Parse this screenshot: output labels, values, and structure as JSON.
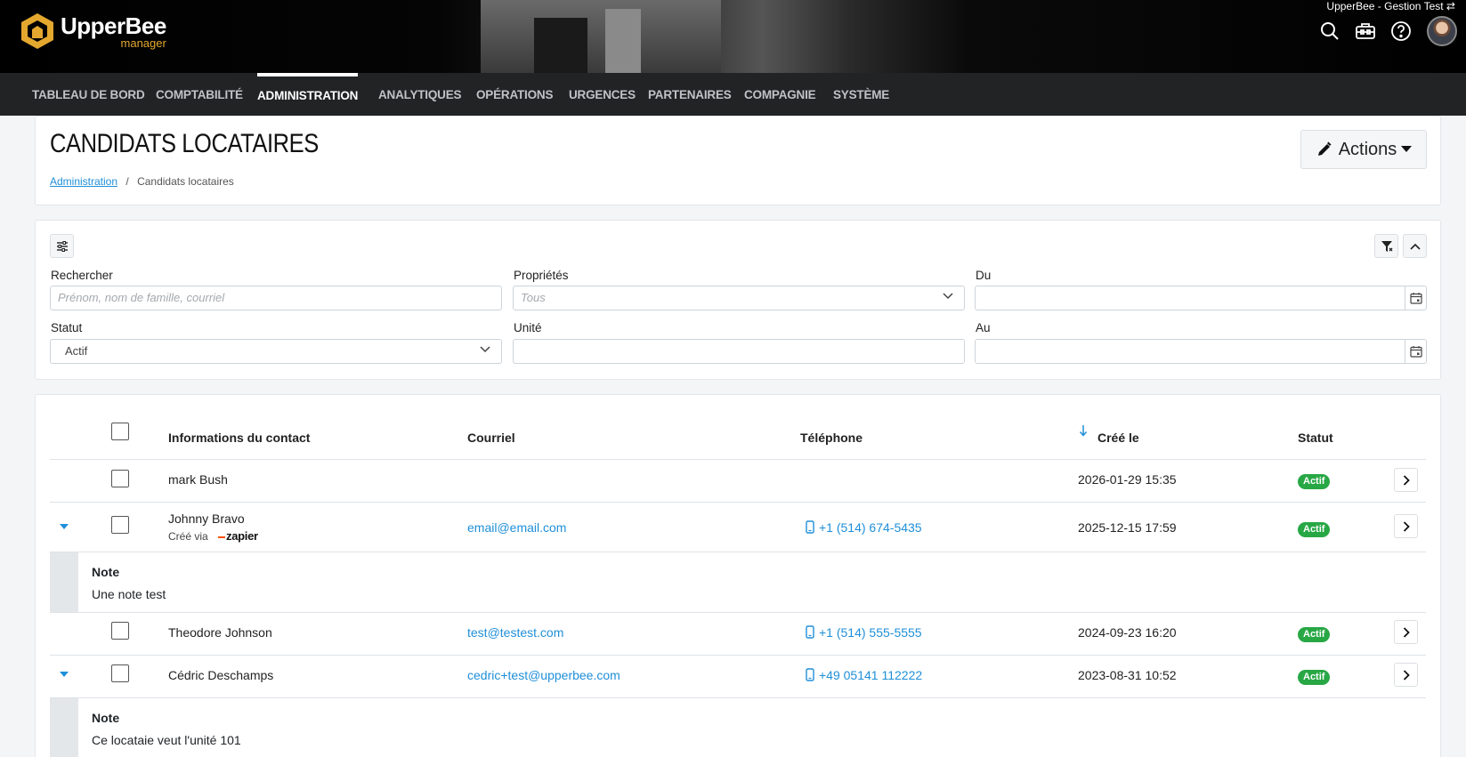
{
  "header": {
    "brand_name": "UpperBee",
    "brand_sub": "manager",
    "account_label": "UpperBee - Gestion Test ⇄"
  },
  "icons": [
    "search-icon",
    "toolbox-icon",
    "help-icon",
    "avatar"
  ],
  "nav": {
    "items": [
      {
        "label": "TABLEAU DE BORD",
        "active": false
      },
      {
        "label": "COMPTABILITÉ",
        "active": false
      },
      {
        "label": "ADMINISTRATION",
        "active": true
      },
      {
        "label": "ANALYTIQUES",
        "active": false
      },
      {
        "label": "OPÉRATIONS",
        "active": false
      },
      {
        "label": "URGENCES",
        "active": false
      },
      {
        "label": "PARTENAIRES",
        "active": false
      },
      {
        "label": "COMPAGNIE",
        "active": false
      },
      {
        "label": "SYSTÈME",
        "active": false
      }
    ]
  },
  "page": {
    "title": "CANDIDATS LOCATAIRES",
    "breadcrumb_link": "Administration",
    "breadcrumb_sep": "/",
    "breadcrumb_current": "Candidats locataires",
    "actions_label": "Actions"
  },
  "filters": {
    "search_label": "Rechercher",
    "search_placeholder": "Prénom, nom de famille, courriel",
    "properties_label": "Propriétés",
    "properties_value": "Tous",
    "from_label": "Du",
    "status_label": "Statut",
    "status_value": "Actif",
    "unit_label": "Unité",
    "to_label": "Au"
  },
  "table": {
    "headers": {
      "contact": "Informations du contact",
      "email": "Courriel",
      "phone": "Téléphone",
      "created": "Créé le",
      "status": "Statut"
    },
    "rows": [
      {
        "name": "mark Bush",
        "email": "",
        "phone": "",
        "created": "2026-01-29 15:35",
        "status": "Actif",
        "expanded": false
      },
      {
        "name": "Johnny Bravo",
        "via_label": "Créé via",
        "via_source": "zapier",
        "email": "email@email.com",
        "phone": "+1 (514) 674-5435",
        "created": "2025-12-15 17:59",
        "status": "Actif",
        "expanded": true,
        "note_title": "Note",
        "note_text": "Une note test"
      },
      {
        "name": "Theodore Johnson",
        "email": "test@testest.com",
        "phone": "+1 (514) 555-5555",
        "created": "2024-09-23 16:20",
        "status": "Actif",
        "expanded": false
      },
      {
        "name": "Cédric Deschamps",
        "email": "cedric+test@upperbee.com",
        "phone": "+49 05141 112222",
        "created": "2023-08-31 10:52",
        "status": "Actif",
        "expanded": true,
        "note_title": "Note",
        "note_text": "Ce locataie veut l'unité 101"
      }
    ]
  },
  "colors": {
    "accent": "#1f8fd8",
    "status_active": "#28a745",
    "brand_gold": "#e4a82f",
    "nav_bg": "#222324"
  }
}
